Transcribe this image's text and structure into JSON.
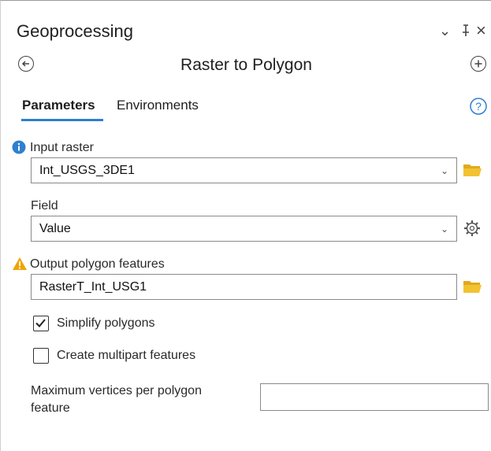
{
  "window": {
    "title": "Geoprocessing",
    "controls": {
      "options": "⌄",
      "pin": "ᚹ",
      "close": "×"
    }
  },
  "tool": {
    "name": "Raster to Polygon"
  },
  "tabs": [
    {
      "label": "Parameters",
      "active": true
    },
    {
      "label": "Environments",
      "active": false
    }
  ],
  "params": {
    "input_raster": {
      "label": "Input raster",
      "value": "Int_USGS_3DE1"
    },
    "field": {
      "label": "Field",
      "value": "Value"
    },
    "output": {
      "label": "Output polygon features",
      "value": "RasterT_Int_USG1"
    },
    "simplify": {
      "label": "Simplify polygons",
      "checked": true
    },
    "multipart": {
      "label": "Create multipart features",
      "checked": false
    },
    "max_vertices": {
      "label_line1": "Maximum vertices per polygon",
      "label_line2": "feature",
      "value": ""
    }
  },
  "colors": {
    "accent": "#2f7fd0",
    "info": "#2f7fd0",
    "warning": "#f0a400",
    "folder": "#f2c231"
  }
}
